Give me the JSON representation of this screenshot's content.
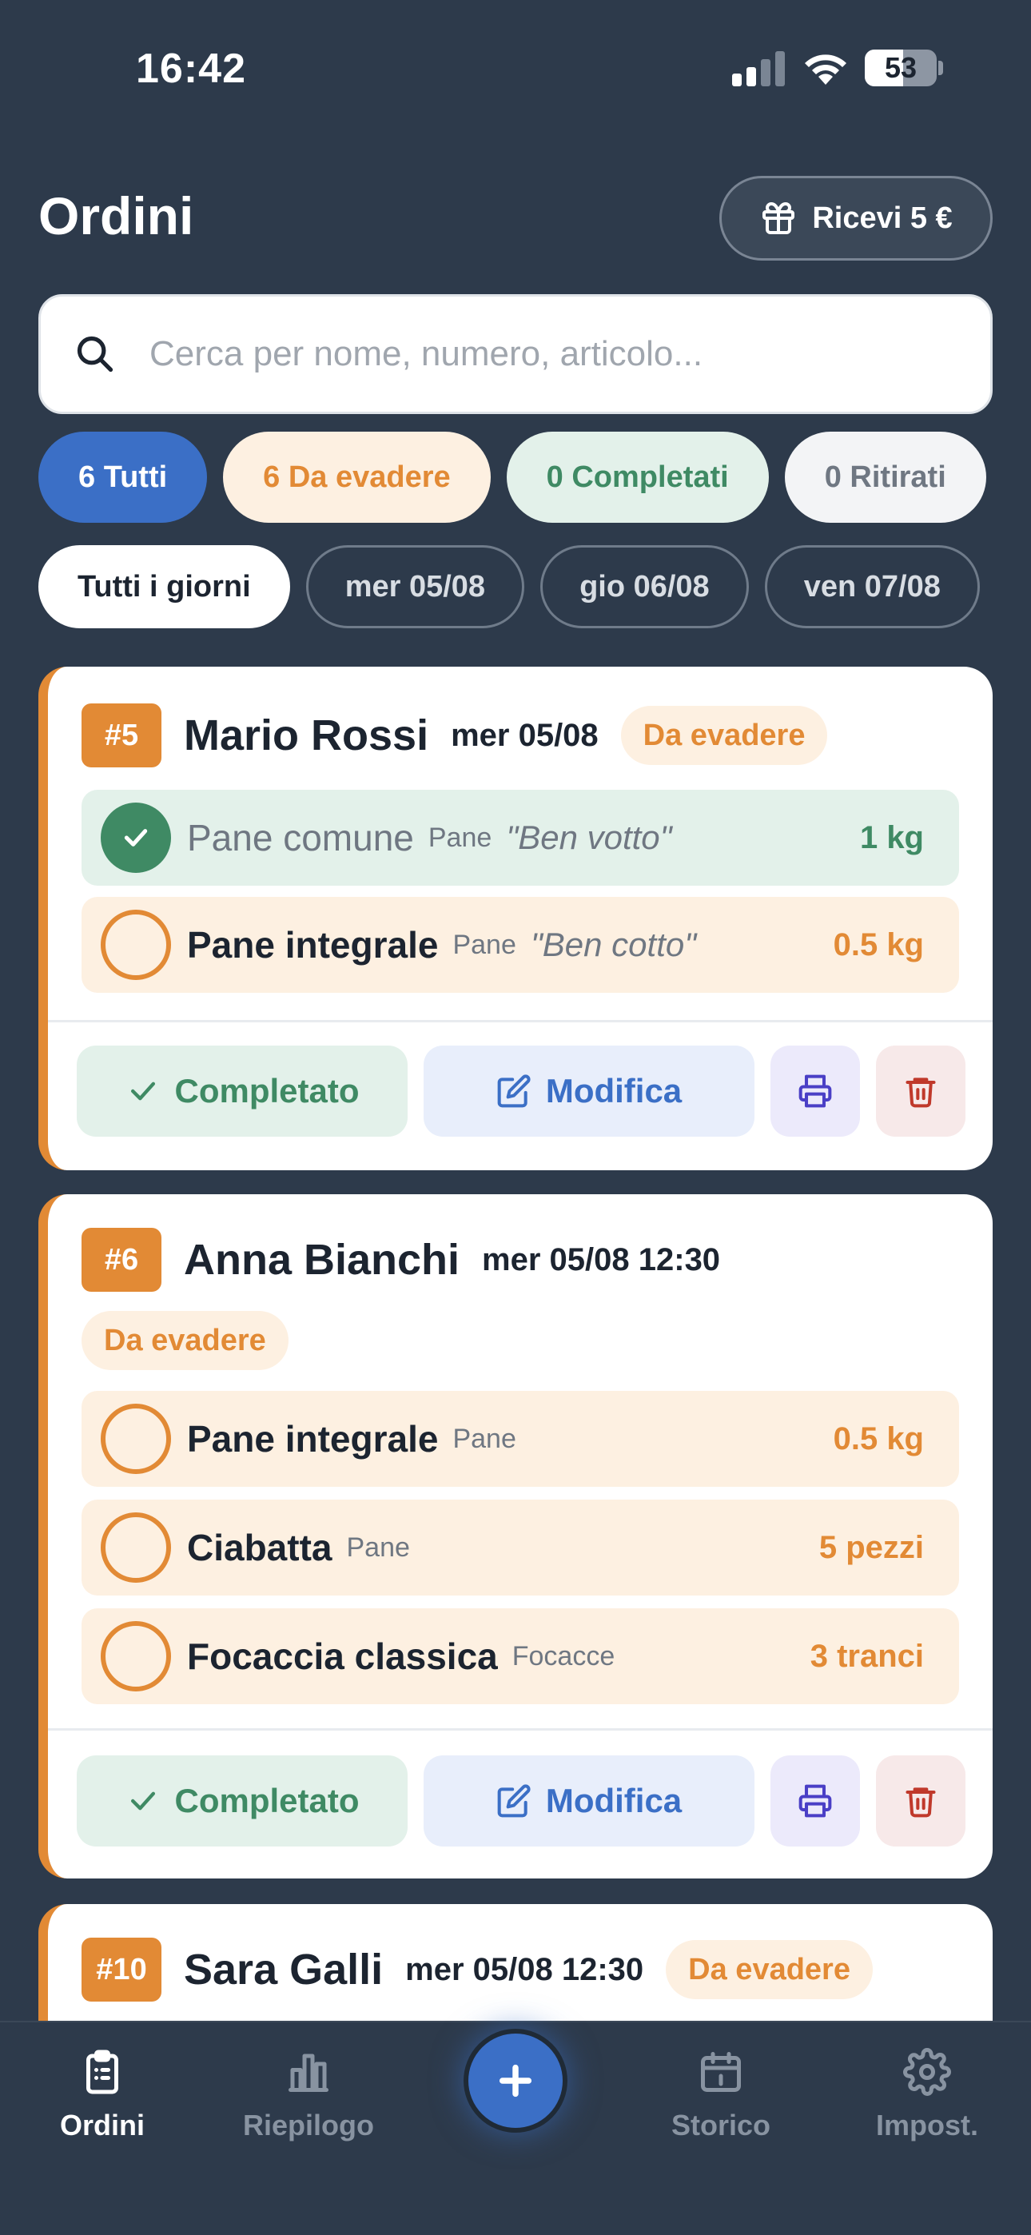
{
  "status_bar": {
    "time": "16:42",
    "battery": "53",
    "battery_level": 0.53
  },
  "header": {
    "title": "Ordini",
    "referral_label": "Ricevi 5 €"
  },
  "search": {
    "placeholder": "Cerca per nome, numero, articolo..."
  },
  "status_filters": [
    {
      "label": "6 Tutti"
    },
    {
      "label": "6 Da evadere"
    },
    {
      "label": "0 Completati"
    },
    {
      "label": "0 Ritirati"
    }
  ],
  "day_filters": [
    {
      "label": "Tutti i giorni"
    },
    {
      "label": "mer 05/08"
    },
    {
      "label": "gio 06/08"
    },
    {
      "label": "ven 07/08"
    }
  ],
  "orders": [
    {
      "number": "#5",
      "customer": "Mario Rossi",
      "date": "mer 05/08",
      "status": "Da evadere",
      "items": [
        {
          "name": "Pane comune",
          "category": "Pane",
          "note": "\"Ben votto\"",
          "qty": "1 kg",
          "done": true
        },
        {
          "name": "Pane integrale",
          "category": "Pane",
          "note": "\"Ben cotto\"",
          "qty": "0.5 kg",
          "done": false
        }
      ]
    },
    {
      "number": "#6",
      "customer": "Anna Bianchi",
      "date": "mer 05/08 12:30",
      "status": "Da evadere",
      "items": [
        {
          "name": "Pane integrale",
          "category": "Pane",
          "qty": "0.5 kg",
          "done": false
        },
        {
          "name": "Ciabatta",
          "category": "Pane",
          "qty": "5 pezzi",
          "done": false
        },
        {
          "name": "Focaccia classica",
          "category": "Focacce",
          "qty": "3 tranci",
          "done": false
        }
      ]
    },
    {
      "number": "#10",
      "customer": "Sara Galli",
      "date": "mer 05/08 12:30",
      "status": "Da evadere"
    }
  ],
  "actions": {
    "complete_label": "Completato",
    "edit_label": "Modifica"
  },
  "nav": [
    {
      "label": "Ordini"
    },
    {
      "label": "Riepilogo"
    },
    {
      "label": "Storico"
    },
    {
      "label": "Impost."
    }
  ],
  "colors": {
    "background": "#2d3a4b",
    "accent_blue": "#3b6fc6",
    "accent_orange": "#e28a35",
    "accent_green": "#3f8a64",
    "danger": "#c0392b"
  },
  "icons": [
    "search-icon",
    "gift-icon",
    "check-icon",
    "edit-icon",
    "printer-icon",
    "trash-icon",
    "clipboard-icon",
    "bar-chart-icon",
    "plus-icon",
    "calendar-icon",
    "gear-icon"
  ]
}
